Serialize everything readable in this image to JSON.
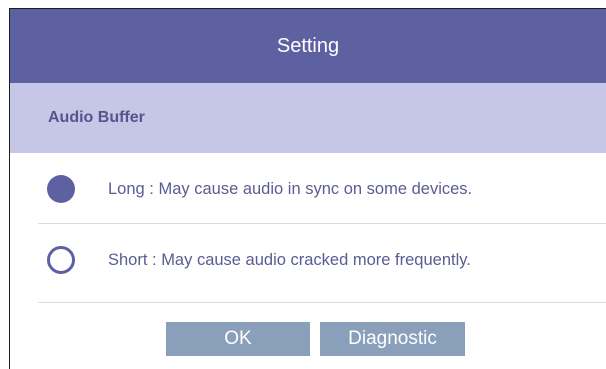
{
  "dialog": {
    "title": "Setting",
    "section": {
      "title": "Audio Buffer"
    },
    "options": [
      {
        "label": "Long : May cause audio in sync on some devices.",
        "selected": true
      },
      {
        "label": "Short : May cause audio cracked more frequently.",
        "selected": false
      }
    ],
    "buttons": {
      "ok_label": "OK",
      "diagnostic_label": "Diagnostic"
    }
  },
  "colors": {
    "title_bar": "#5d61a2",
    "section_header": "#c6c7e6",
    "text_primary": "#5a5c93",
    "button": "#8a9fba"
  }
}
